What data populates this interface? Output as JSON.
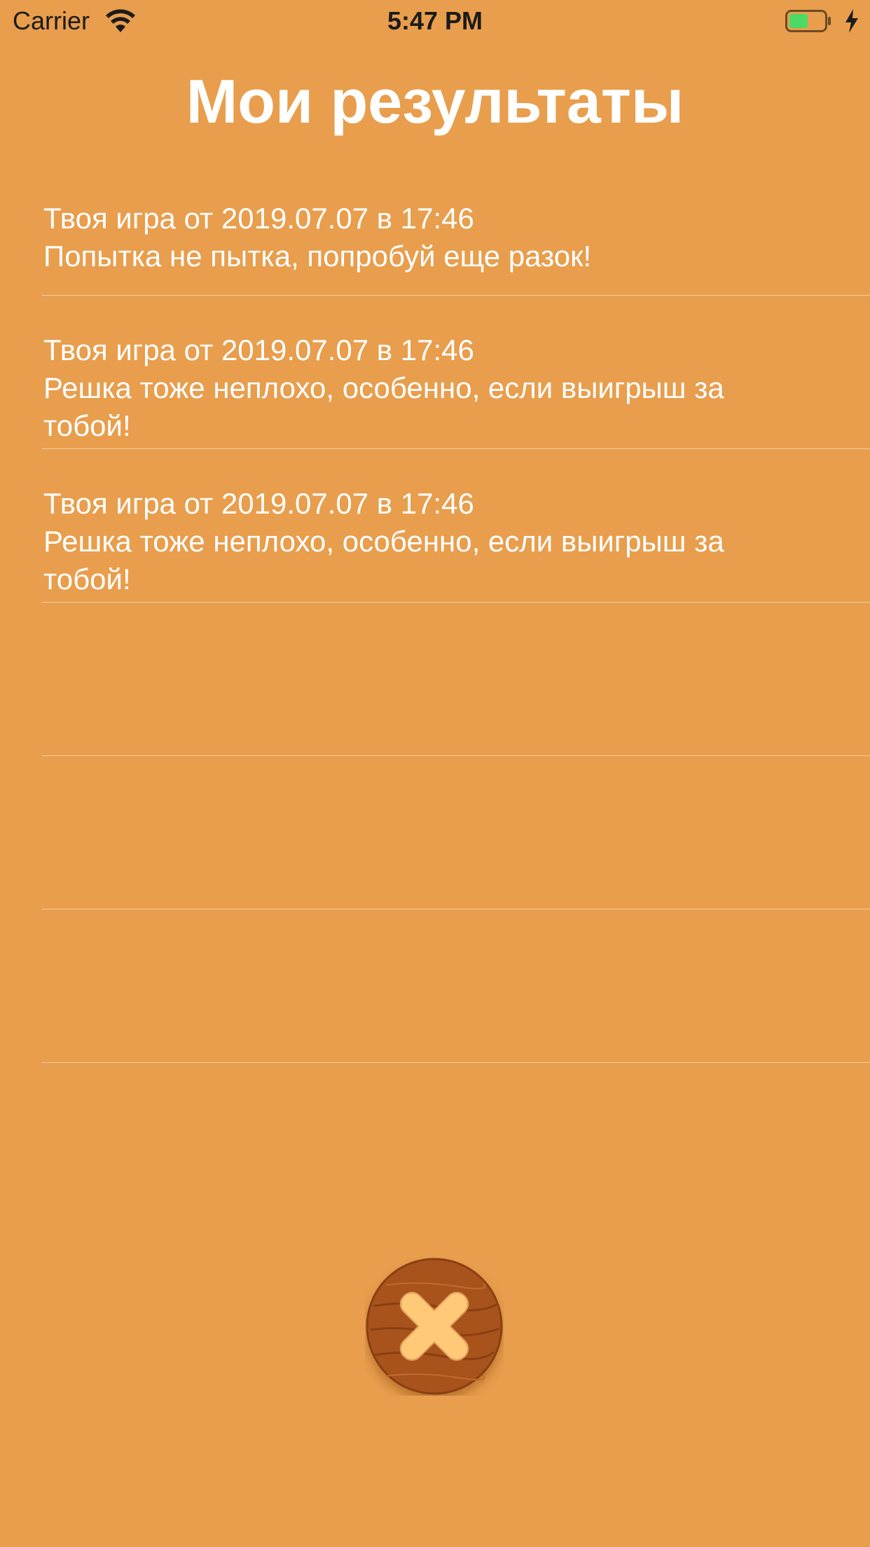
{
  "status_bar": {
    "carrier": "Carrier",
    "time": "5:47 PM",
    "wifi_icon": "wifi-icon",
    "battery_icon": "battery-charging-icon",
    "battery_fill_color": "#4CD964"
  },
  "header": {
    "title": "Мои результаты"
  },
  "results": [
    {
      "date": "Твоя игра от 2019.07.07 в 17:46",
      "message": "Попытка не пытка, попробуй еще разок!"
    },
    {
      "date": "Твоя игра от 2019.07.07 в 17:46",
      "message": "Решка тоже неплохо, особенно, если выигрыш за тобой!"
    },
    {
      "date": "Твоя игра от 2019.07.07 в 17:46",
      "message": "Решка тоже неплохо, особенно, если выигрыш за тобой!"
    }
  ],
  "close_button": {
    "icon": "close-icon"
  },
  "colors": {
    "background": "#E89E4D",
    "text": "#FFFFFF",
    "button_wood": "#A9531F",
    "button_cross": "#FFC977"
  }
}
